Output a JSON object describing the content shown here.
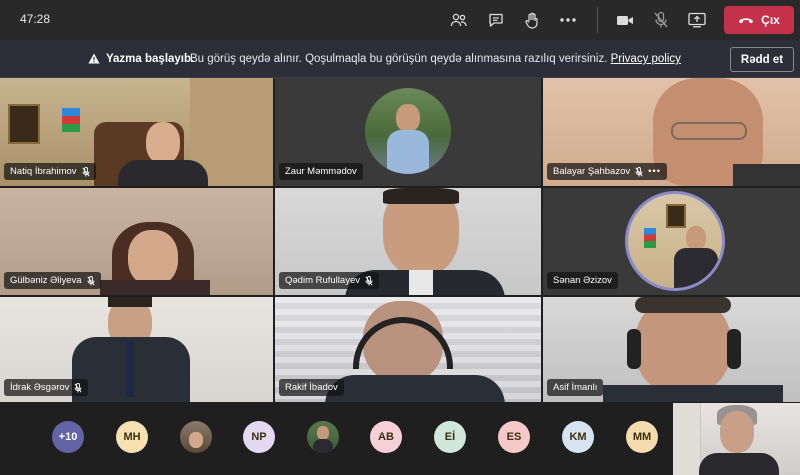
{
  "topbar": {
    "timer": "47:28",
    "leave_label": "Çıx"
  },
  "banner": {
    "title": "Yazma başlayıb.",
    "text": "Bu görüş qeydə alınır. Qoşulmaqla bu görüşün qeydə alınmasına razılıq verirsiniz.",
    "link": "Privacy policy",
    "decline_label": "Rədd et"
  },
  "participants": [
    {
      "name": "Natiq İbrahimov",
      "muted": true
    },
    {
      "name": "Zaur Məmmədov",
      "muted": false
    },
    {
      "name": "Balayar Şahbazov",
      "muted": true
    },
    {
      "name": "Gülbəniz Əliyeva",
      "muted": true
    },
    {
      "name": "Qədim Rufullayev",
      "muted": true
    },
    {
      "name": "Sənan Əzizov",
      "muted": false
    },
    {
      "name": "İdrak Əsgərov",
      "muted": true
    },
    {
      "name": "Rakif İbadov",
      "muted": false
    },
    {
      "name": "Asif İmanlı",
      "muted": false
    }
  ],
  "bottom": {
    "overflow": "+10",
    "avatars": [
      "MH",
      "NP",
      "AB",
      "Eİ",
      "ES",
      "KM",
      "MM"
    ]
  },
  "colors": {
    "leave": "#c4314b",
    "overflow_avatar": "#6264a7",
    "avatar_mh": "#f6e0b0",
    "avatar_np": "#e3d9f2",
    "avatar_ab": "#f6d0d6",
    "avatar_ei": "#cfe8d9",
    "avatar_es": "#f6c9c9",
    "avatar_km": "#d6e4f2",
    "avatar_mm": "#f5dcae"
  }
}
